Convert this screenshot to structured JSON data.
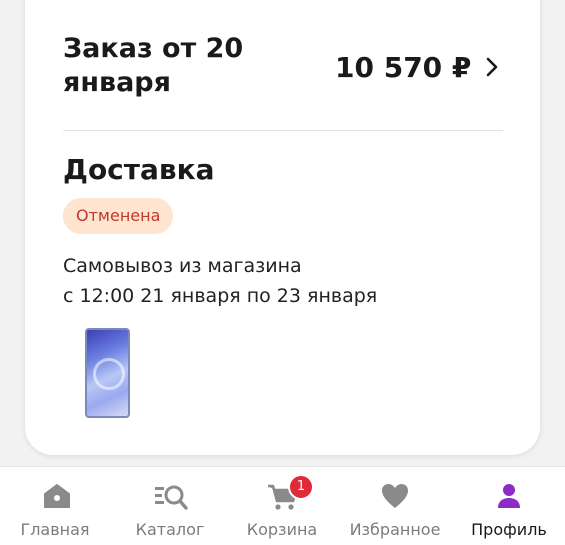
{
  "order": {
    "title": "Заказ от 20 января",
    "total": "10 570 ₽"
  },
  "delivery": {
    "title": "Доставка",
    "status": "Отменена",
    "method": "Самовывоз из магазина",
    "period": "с 12:00 21 января по 23 января"
  },
  "product": {
    "image": "smartphone-thumbnail"
  },
  "tabbar": {
    "tabs": [
      {
        "label": "Главная",
        "icon": "home-icon"
      },
      {
        "label": "Каталог",
        "icon": "catalog-search-icon"
      },
      {
        "label": "Корзина",
        "icon": "cart-icon",
        "badge": "1"
      },
      {
        "label": "Избранное",
        "icon": "heart-icon"
      },
      {
        "label": "Профиль",
        "icon": "profile-icon",
        "active": true
      }
    ]
  },
  "colors": {
    "status_bg": "#ffe4cf",
    "status_text": "#c0392b",
    "active_tab": "#8b2cc9",
    "inactive_icon": "#8a8a8a",
    "cart_badge": "#e02a3a"
  }
}
